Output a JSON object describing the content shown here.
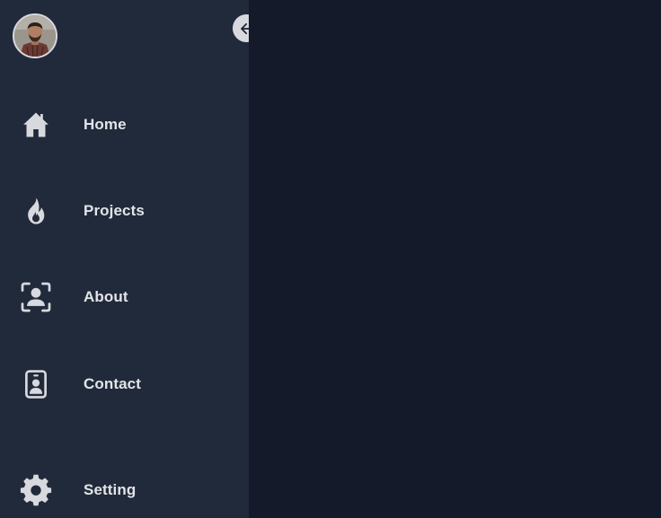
{
  "sidebar": {
    "avatar_alt": "User avatar",
    "items": [
      {
        "label": "Home",
        "icon": "home-icon"
      },
      {
        "label": "Projects",
        "icon": "fire-icon"
      },
      {
        "label": "About",
        "icon": "user-scan-icon"
      },
      {
        "label": "Contact",
        "icon": "id-badge-icon"
      },
      {
        "label": "Setting",
        "icon": "gear-icon"
      }
    ],
    "collapse_icon": "arrow-left-icon"
  },
  "colors": {
    "sidebar_bg": "#212a3a",
    "main_bg": "#141a29",
    "text": "#e2e4e8",
    "icon": "#d7d9de"
  }
}
